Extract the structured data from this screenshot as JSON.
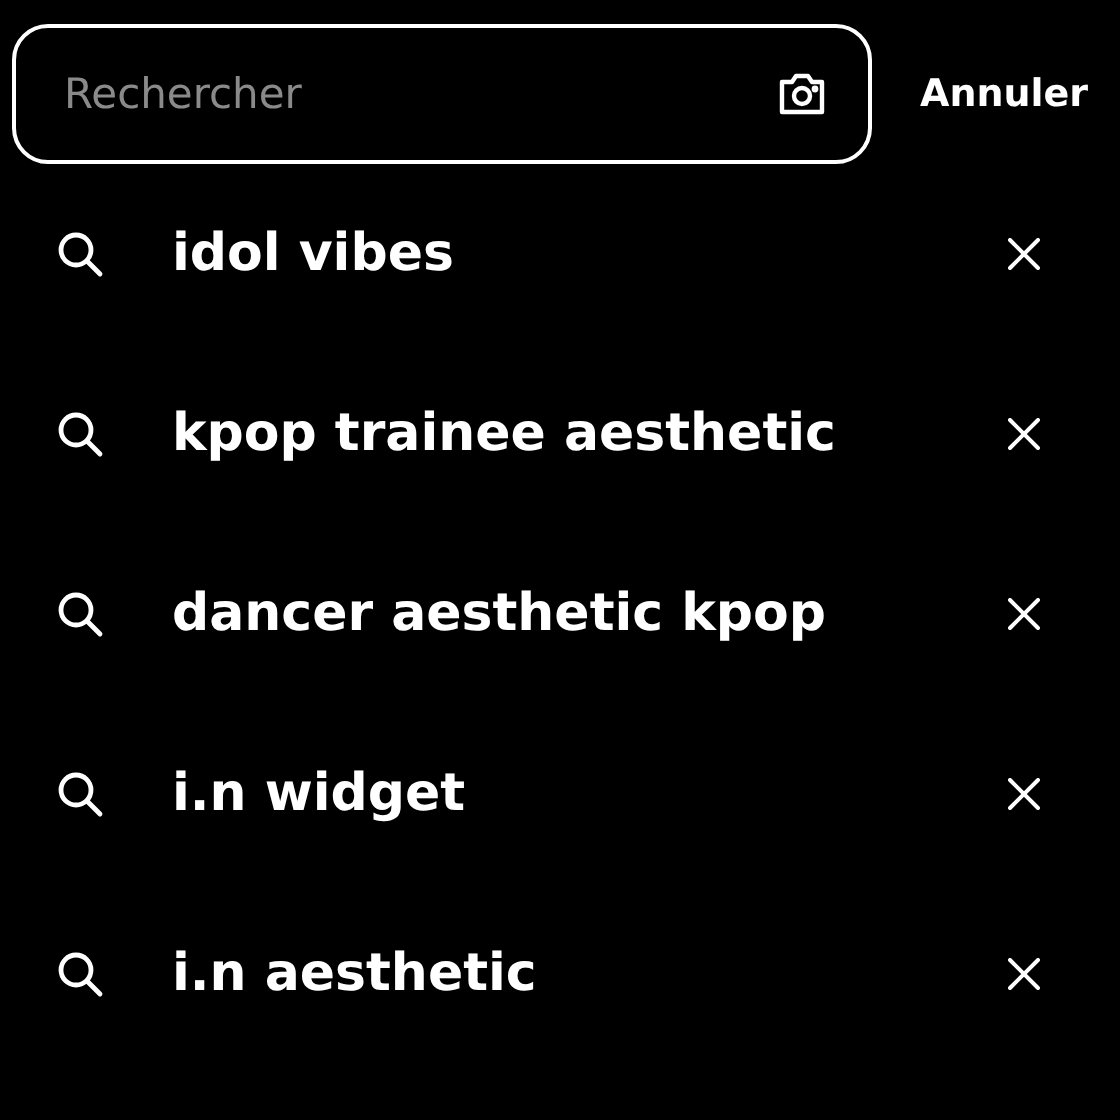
{
  "search": {
    "placeholder": "Rechercher",
    "cancel": "Annuler"
  },
  "history": [
    {
      "text": "idol vibes"
    },
    {
      "text": "kpop trainee aesthetic"
    },
    {
      "text": "dancer aesthetic kpop"
    },
    {
      "text": "i.n widget"
    },
    {
      "text": "i.n aesthetic"
    }
  ]
}
